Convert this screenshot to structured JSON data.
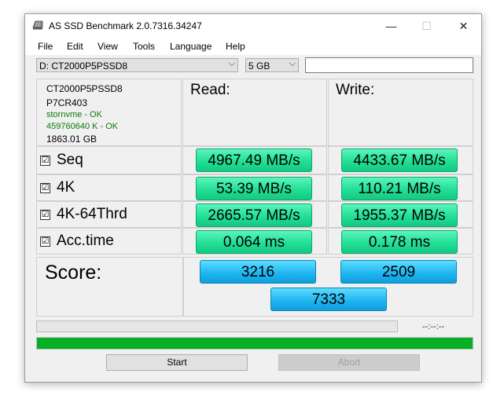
{
  "window": {
    "title": "AS SSD Benchmark 2.0.7316.34247",
    "minimize": "—",
    "maximize": "☐",
    "close": "✕"
  },
  "menu": [
    "File",
    "Edit",
    "View",
    "Tools",
    "Language",
    "Help"
  ],
  "toolbar": {
    "drive": "D: CT2000P5PSSD8",
    "size": "5 GB",
    "text_value": ""
  },
  "drive_info": {
    "model": "CT2000P5PSSD8",
    "firmware": "P7CR403",
    "driver": "stornvme - OK",
    "alignment": "459760640 K - OK",
    "capacity": "1863.01 GB"
  },
  "headers": {
    "read": "Read:",
    "write": "Write:"
  },
  "rows": [
    {
      "label": "Seq",
      "checked": "☑",
      "read": "4967.49 MB/s",
      "write": "4433.67 MB/s"
    },
    {
      "label": "4K",
      "checked": "☑",
      "read": "53.39 MB/s",
      "write": "110.21 MB/s"
    },
    {
      "label": "4K-64Thrd",
      "checked": "☑",
      "read": "2665.57 MB/s",
      "write": "1955.37 MB/s"
    },
    {
      "label": "Acc.time",
      "checked": "☑",
      "read": "0.064 ms",
      "write": "0.178 ms"
    }
  ],
  "score": {
    "label": "Score:",
    "read": "3216",
    "write": "2509",
    "total": "7333"
  },
  "status": {
    "timer": "--:--:--",
    "progress_fraction": 1.0
  },
  "buttons": {
    "start": "Start",
    "abort": "Abort"
  }
}
